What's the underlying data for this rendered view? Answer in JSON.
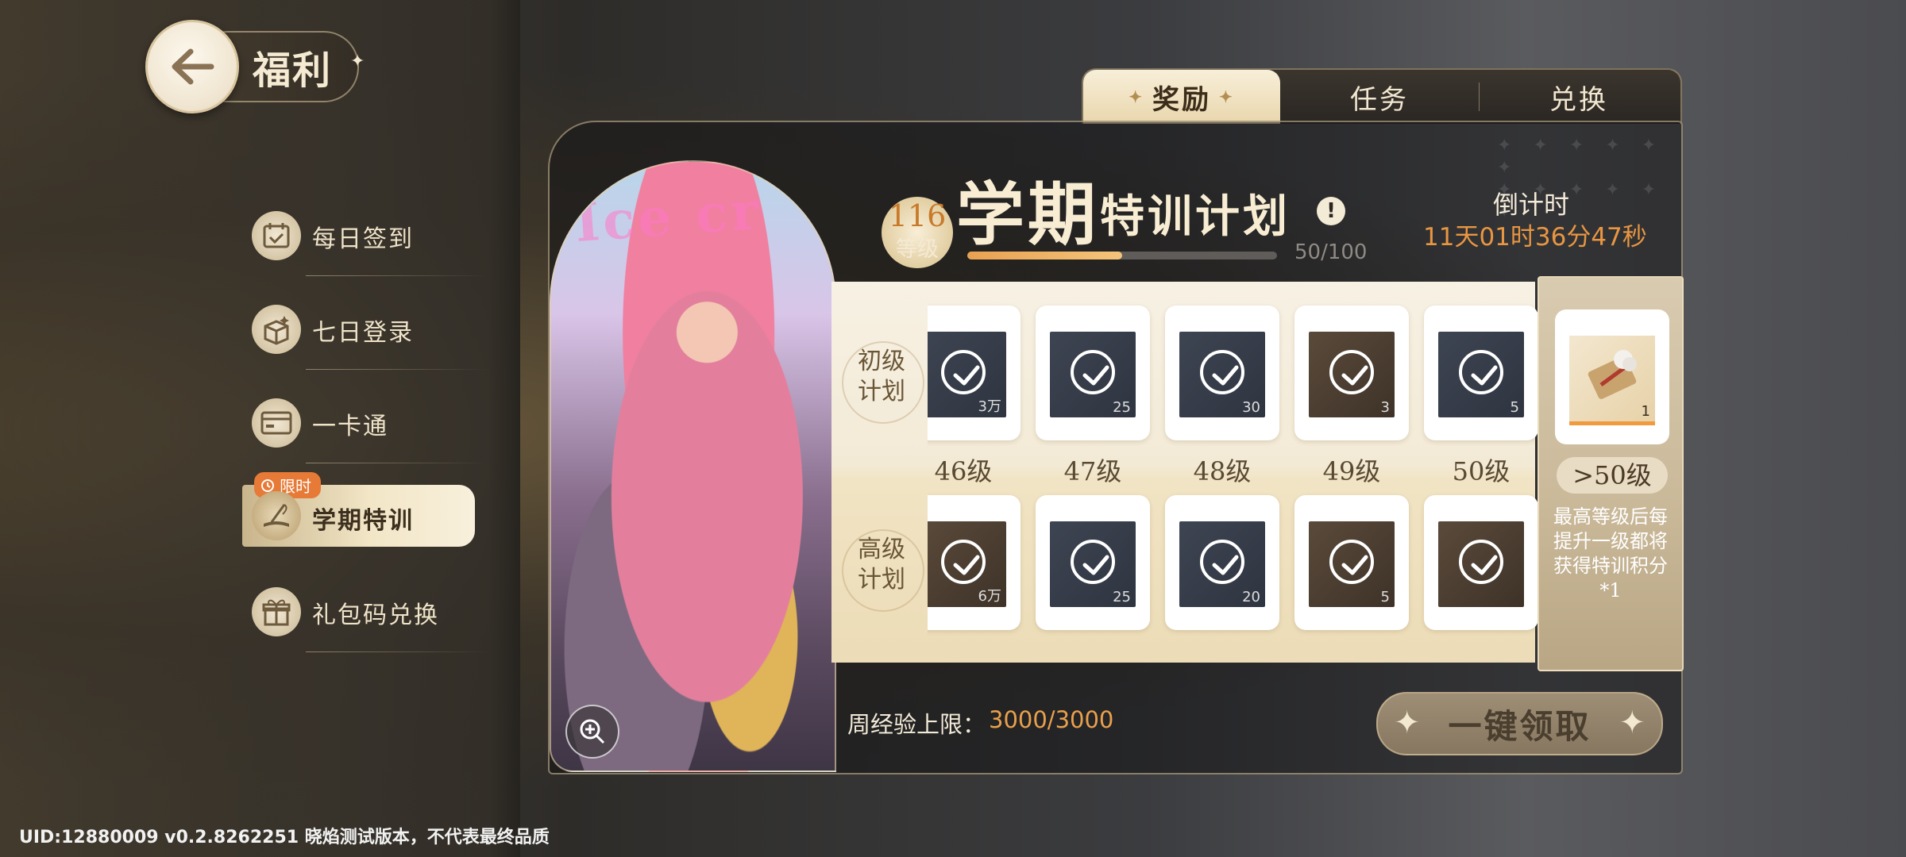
{
  "header": {
    "back_title": "福利"
  },
  "sidebar": {
    "items": [
      {
        "label": "每日签到",
        "icon": "calendar-check-icon"
      },
      {
        "label": "七日登录",
        "icon": "gift-box-sparkle-icon"
      },
      {
        "label": "一卡通",
        "icon": "card-icon"
      },
      {
        "label": "学期特训",
        "icon": "book-quill-icon",
        "badge": "限时",
        "active": true
      },
      {
        "label": "礼包码兑换",
        "icon": "gift-icon"
      }
    ]
  },
  "tabs": [
    {
      "label": "奖励",
      "active": true
    },
    {
      "label": "任务",
      "active": false
    },
    {
      "label": "兑换",
      "active": false
    }
  ],
  "plan": {
    "level": "116",
    "level_label": "等级",
    "title_big": "学期",
    "title_small": "特训计划",
    "xp_current": 50,
    "xp_max": 100,
    "xp_text": "50/100",
    "countdown_label": "倒计时",
    "countdown_value": "11天01时36分47秒"
  },
  "rewards": {
    "basic_label": "初级\n计划",
    "advanced_label": "高级\n计划",
    "levels": [
      "46级",
      "47级",
      "48级",
      "49级",
      "50级"
    ],
    "basic_items": [
      {
        "qty": "3万",
        "claimed": true
      },
      {
        "qty": "25",
        "claimed": true
      },
      {
        "qty": "30",
        "claimed": true
      },
      {
        "qty": "3",
        "claimed": true
      },
      {
        "qty": "5",
        "claimed": true
      }
    ],
    "advanced_items": [
      {
        "qty": "6万",
        "claimed": true
      },
      {
        "qty": "25",
        "claimed": true
      },
      {
        "qty": "20",
        "claimed": true
      },
      {
        "qty": "5",
        "claimed": true
      },
      {
        "qty": "",
        "claimed": true
      }
    ],
    "final": {
      "qty": "1",
      "level_label": ">50级",
      "desc": "最高等级后每提升一级都将获得特训积分*1"
    }
  },
  "weekly": {
    "label": "周经验上限：",
    "value": "3000/3000"
  },
  "claim_button": "一键领取",
  "footer": {
    "uid_text": "UID:12880009 v0.2.8262251 晓焰测试版本，不代表最终品质"
  },
  "colors": {
    "accent_orange": "#e89642",
    "cream": "#f8edd3",
    "badge_orange": "#e67a36"
  }
}
